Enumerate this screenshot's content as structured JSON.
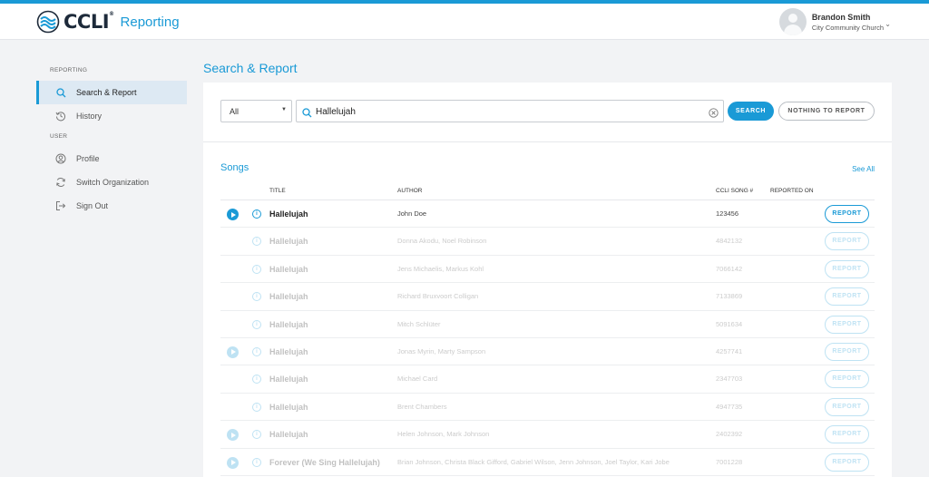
{
  "brand": {
    "logo_text": "CCLI",
    "app_name": "Reporting",
    "accent": "#1a9ad6"
  },
  "user": {
    "name": "Brandon Smith",
    "org": "City Community Church",
    "chevron": "⌄"
  },
  "sidebar": {
    "sections": [
      {
        "label": "REPORTING"
      },
      {
        "label": "USER"
      }
    ],
    "items": [
      {
        "label": "Search & Report",
        "icon": "search-icon",
        "active": true
      },
      {
        "label": "History",
        "icon": "history-icon"
      },
      {
        "label": "Profile",
        "icon": "profile-icon"
      },
      {
        "label": "Switch Organization",
        "icon": "switch-icon"
      },
      {
        "label": "Sign Out",
        "icon": "sign-out-icon"
      }
    ]
  },
  "page": {
    "title": "Search & Report"
  },
  "search": {
    "filter_value": "All",
    "query": "Hallelujah",
    "search_label": "SEARCH",
    "nothing_label": "NOTHING TO REPORT"
  },
  "songs": {
    "title": "Songs",
    "see_all": "See All",
    "headers": {
      "title": "TITLE",
      "author": "AUTHOR",
      "song_no": "CCLI SONG #",
      "reported_on": "REPORTED ON"
    },
    "report_label": "REPORT",
    "rows": [
      {
        "title": "Hallelujah",
        "author": "John Doe",
        "song_no": "123456",
        "has_play": true,
        "dimmed": false
      },
      {
        "title": "Hallelujah",
        "author": "Donna Akodu, Noel Robinson",
        "song_no": "4842132",
        "has_play": false,
        "dimmed": true
      },
      {
        "title": "Hallelujah",
        "author": "Jens Michaelis, Markus Kohl",
        "song_no": "7066142",
        "has_play": false,
        "dimmed": true
      },
      {
        "title": "Hallelujah",
        "author": "Richard Bruxvoort Colligan",
        "song_no": "7133869",
        "has_play": false,
        "dimmed": true
      },
      {
        "title": "Hallelujah",
        "author": "Mitch Schlüter",
        "song_no": "5091634",
        "has_play": false,
        "dimmed": true
      },
      {
        "title": "Hallelujah",
        "author": "Jonas Myrin, Marty Sampson",
        "song_no": "4257741",
        "has_play": true,
        "dimmed": true
      },
      {
        "title": "Hallelujah",
        "author": "Michael Card",
        "song_no": "2347703",
        "has_play": false,
        "dimmed": true
      },
      {
        "title": "Hallelujah",
        "author": "Brent Chambers",
        "song_no": "4947735",
        "has_play": false,
        "dimmed": true
      },
      {
        "title": "Hallelujah",
        "author": "Helen Johnson, Mark Johnson",
        "song_no": "2402392",
        "has_play": true,
        "dimmed": true
      },
      {
        "title": "Forever (We Sing Hallelujah)",
        "author": "Brian Johnson, Christa Black Gifford, Gabriel Wilson, Jenn Johnson, Joel Taylor, Kari Jobe",
        "song_no": "7001228",
        "has_play": true,
        "dimmed": true
      }
    ]
  }
}
